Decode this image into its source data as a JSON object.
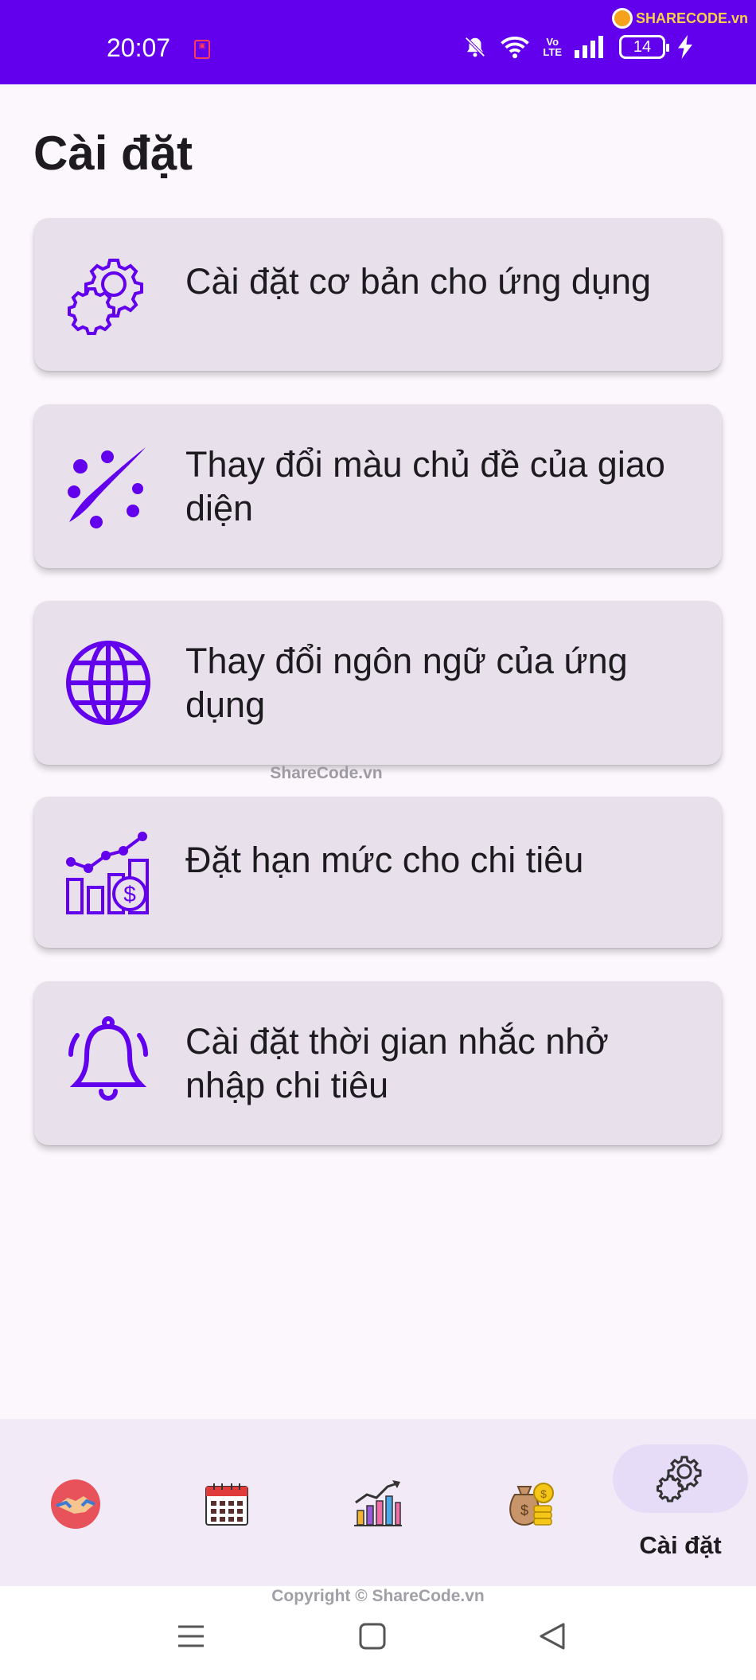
{
  "status_bar": {
    "time": "20:07",
    "battery": "14",
    "network_label_top": "Vo",
    "network_label_bottom": "LTE",
    "watermark": "SHARECODE.vn",
    "bg_color": "#6200ee"
  },
  "page": {
    "title": "Cài đặt"
  },
  "settings": {
    "items": [
      {
        "label": "Cài đặt cơ bản cho ứng dụng",
        "icon": "gears-icon"
      },
      {
        "label": "Thay đổi màu chủ đề của giao diện",
        "icon": "palette-brush-icon"
      },
      {
        "label": "Thay đổi ngôn ngữ của ứng dụng",
        "icon": "globe-icon"
      },
      {
        "label": "Đặt hạn mức cho chi tiêu",
        "icon": "budget-chart-icon"
      },
      {
        "label": "Cài đặt thời gian nhắc nhở nhập chi tiêu",
        "icon": "bell-icon"
      }
    ],
    "accent_color": "#6200ee"
  },
  "watermark_mid": "ShareCode.vn",
  "bottom_nav": {
    "items": [
      {
        "icon": "handshake-icon"
      },
      {
        "icon": "calendar-icon"
      },
      {
        "icon": "growth-chart-icon"
      },
      {
        "icon": "money-bag-icon"
      },
      {
        "icon": "gear-icon",
        "label": "Cài đặt",
        "active": true
      }
    ]
  },
  "copyright": "Copyright © ShareCode.vn"
}
